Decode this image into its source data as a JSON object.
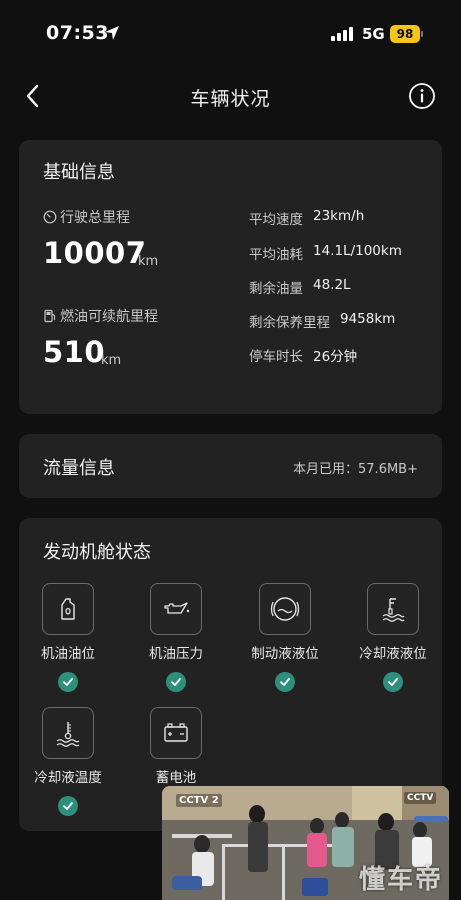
{
  "status_bar": {
    "time": "07:53",
    "network": "5G",
    "battery": "98"
  },
  "nav": {
    "title": "车辆状况"
  },
  "basic_info": {
    "title": "基础信息",
    "odometer_label": "行驶总里程",
    "odometer_value": "10007",
    "odometer_unit": "km",
    "range_label": "燃油可续航里程",
    "range_value": "510",
    "range_unit": "km",
    "details": [
      {
        "key": "平均速度",
        "value": "23km/h"
      },
      {
        "key": "平均油耗",
        "value": "14.1L/100km"
      },
      {
        "key": "剩余油量",
        "value": "48.2L"
      },
      {
        "key": "剩余保养里程",
        "value": "9458km"
      },
      {
        "key": "停车时长",
        "value": "26分钟"
      }
    ]
  },
  "data_flow": {
    "title": "流量信息",
    "usage": "本月已用：57.6MB+"
  },
  "engine": {
    "title": "发动机舱状态",
    "items": [
      {
        "label": "机油油位",
        "icon": "oil-bottle-icon",
        "status": "ok"
      },
      {
        "label": "机油压力",
        "icon": "oil-can-icon",
        "status": "ok"
      },
      {
        "label": "制动液液位",
        "icon": "brake-fluid-icon",
        "status": "ok"
      },
      {
        "label": "冷却液液位",
        "icon": "coolant-level-icon",
        "status": "ok"
      },
      {
        "label": "冷却液温度",
        "icon": "coolant-temp-icon",
        "status": "ok"
      },
      {
        "label": "蓄电池",
        "icon": "battery-icon",
        "status": "none"
      }
    ]
  },
  "video_overlay": {
    "channel": "CCTV 2",
    "channel_2": "CCTV",
    "watermark": "懂车帝"
  },
  "colors": {
    "background": "#101010",
    "card": "#222222",
    "check": "#2f8f7d",
    "battery_badge": "#f5c518"
  }
}
